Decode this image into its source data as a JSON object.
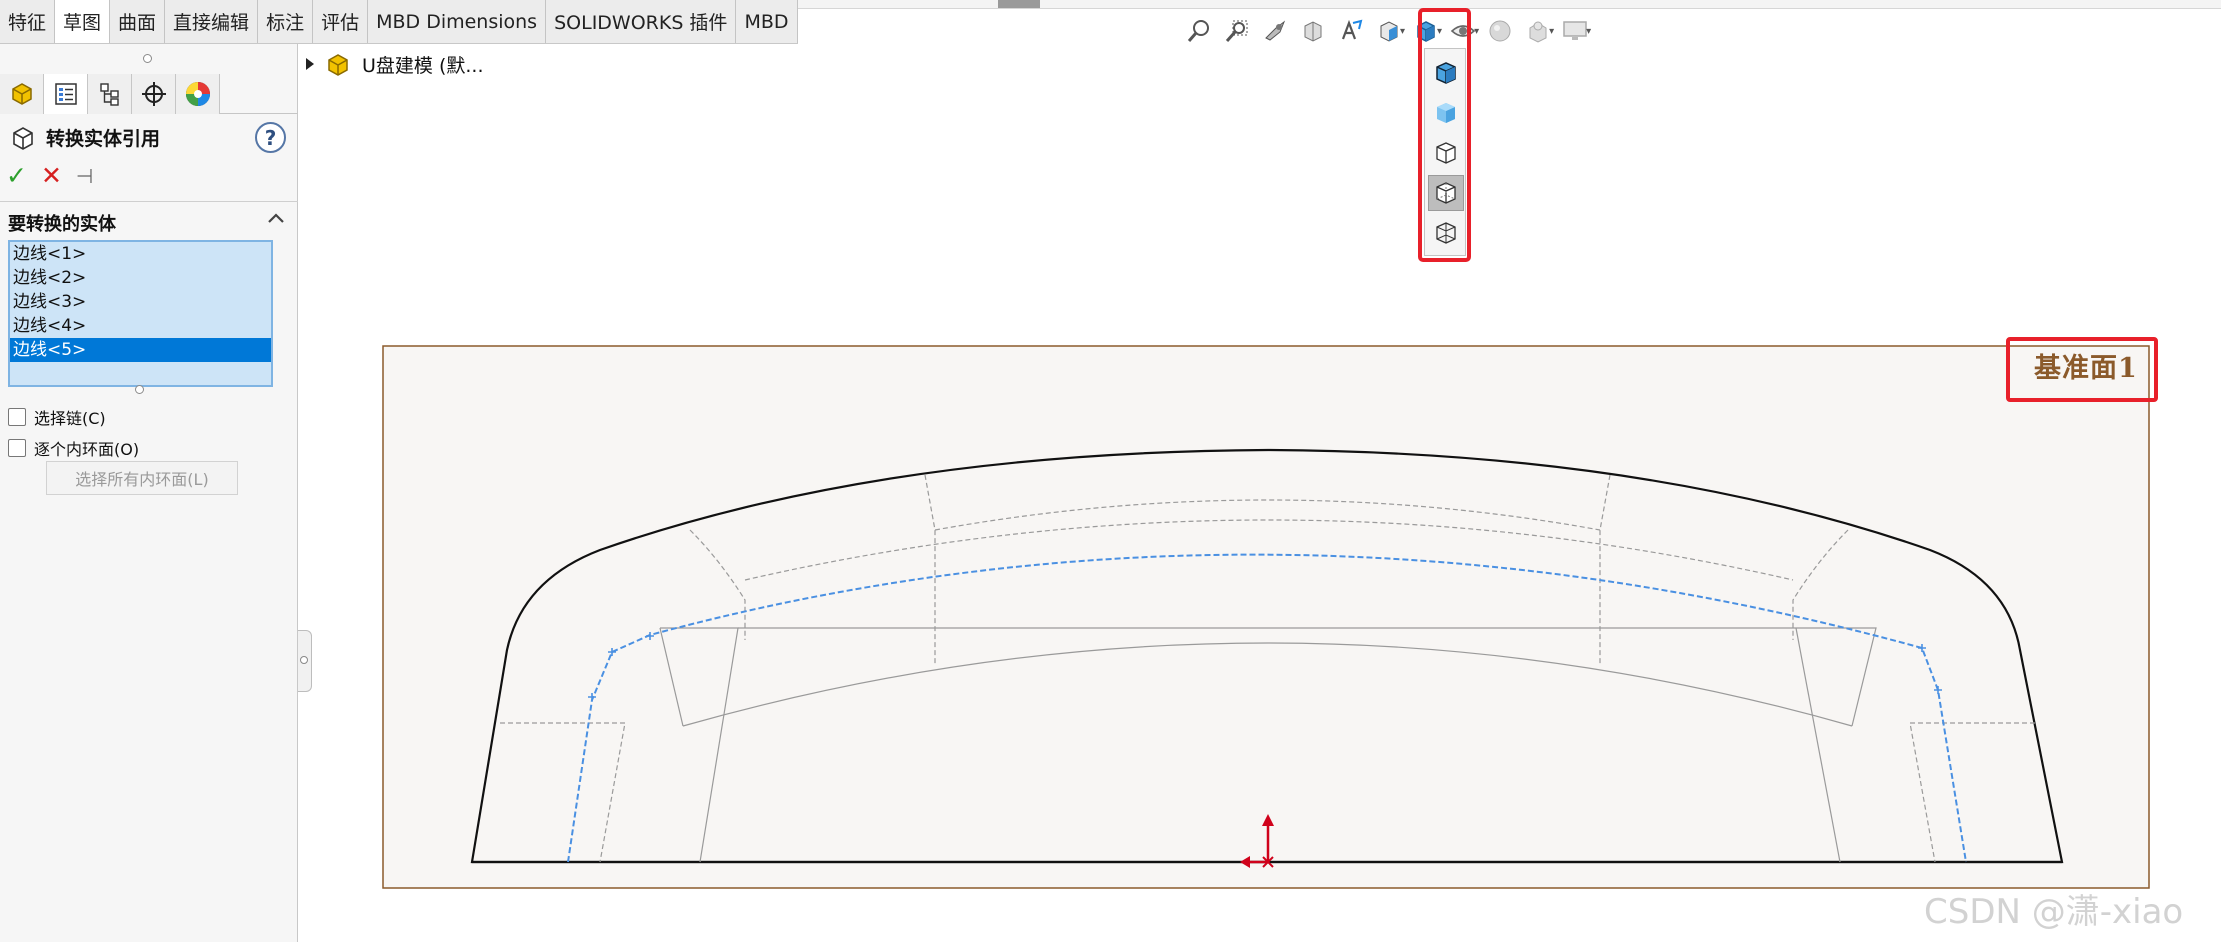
{
  "tabs": [
    "特征",
    "草图",
    "曲面",
    "直接编辑",
    "标注",
    "评估",
    "MBD Dimensions",
    "SOLIDWORKS 插件",
    "MBD"
  ],
  "active_tab_index": 1,
  "property_manager": {
    "title": "转换实体引用",
    "help_label": "?",
    "ok_symbol": "✓",
    "cancel_symbol": "✕",
    "pin_symbol": "⊣",
    "group_title": "要转换的实体",
    "entities": [
      "边线<1>",
      "边线<2>",
      "边线<3>",
      "边线<4>",
      "边线<5>"
    ],
    "selected_entity_index": 4,
    "select_chain_label": "选择链(C)",
    "each_inner_loop_label": "逐个内环面(O)",
    "select_all_inner_loops_label": "选择所有内环面(L)"
  },
  "manager_tabs": [
    "feature-manager-icon",
    "property-manager-icon",
    "configuration-manager-icon",
    "dimxpert-icon",
    "display-manager-icon"
  ],
  "feature_tree": {
    "part_name": "U盘建模 (默..."
  },
  "heads_up_toolbar": [
    "zoom-to-fit-icon",
    "zoom-to-area-icon",
    "previous-view-icon",
    "section-view-icon",
    "dynamic-annotation-icon",
    "view-orientation-icon",
    "display-style-icon",
    "hide-show-icon",
    "edit-appearance-icon",
    "apply-scene-icon",
    "view-settings-icon"
  ],
  "display_style_flyout": [
    "shaded-with-edges-icon",
    "shaded-icon",
    "hidden-lines-removed-icon",
    "hidden-lines-visible-icon",
    "wireframe-icon"
  ],
  "display_style_selected_index": 3,
  "sketch_plane_label": "基准面1",
  "watermark": "CSDN @潇-xiao",
  "colors": {
    "highlight_red": "#e8202a",
    "selection_blue": "#0078d7",
    "list_bg": "#cde4f7",
    "sketch_line_blue": "#4a90e2",
    "plane_border": "#8b5a2b",
    "origin_red": "#d0021b"
  }
}
